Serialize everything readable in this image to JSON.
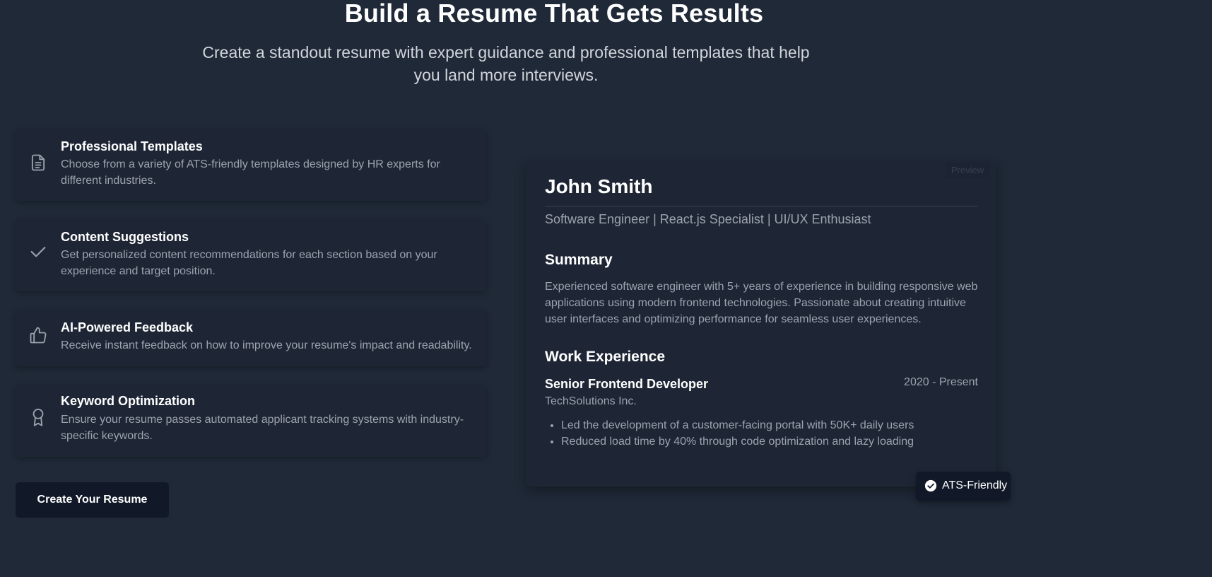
{
  "hero": {
    "title": "Build a Resume That Gets Results",
    "subtitle": "Create a standout resume with expert guidance and professional templates that help you land more interviews."
  },
  "features": [
    {
      "icon": "document-icon",
      "title": "Professional Templates",
      "description": "Choose from a variety of ATS-friendly templates designed by HR experts for different industries."
    },
    {
      "icon": "check-icon",
      "title": "Content Suggestions",
      "description": "Get personalized content recommendations for each section based on your experience and target position."
    },
    {
      "icon": "thumbs-up-icon",
      "title": "AI-Powered Feedback",
      "description": "Receive instant feedback on how to improve your resume's impact and readability."
    },
    {
      "icon": "award-icon",
      "title": "Keyword Optimization",
      "description": "Ensure your resume passes automated applicant tracking systems with industry-specific keywords."
    }
  ],
  "cta": {
    "label": "Create Your Resume"
  },
  "resume": {
    "preview_label": "Preview",
    "name": "John Smith",
    "tagline": "Software Engineer | React.js Specialist | UI/UX Enthusiast",
    "summary_heading": "Summary",
    "summary": "Experienced software engineer with 5+ years of experience in building responsive web applications using modern frontend technologies. Passionate about creating intuitive user interfaces and optimizing performance for seamless user experiences.",
    "experience_heading": "Work Experience",
    "job": {
      "title": "Senior Frontend Developer",
      "dates": "2020 - Present",
      "company": "TechSolutions Inc.",
      "bullets": [
        "Led the development of a customer-facing portal with 50K+ daily users",
        "Reduced load time by 40% through code optimization and lazy loading"
      ]
    }
  },
  "badge": {
    "label": "ATS-Friendly",
    "icon": "check-circle-icon"
  },
  "colors": {
    "background": "#1f2937",
    "card": "#1e2635",
    "button": "#111827",
    "muted_text": "#9ca3af"
  }
}
